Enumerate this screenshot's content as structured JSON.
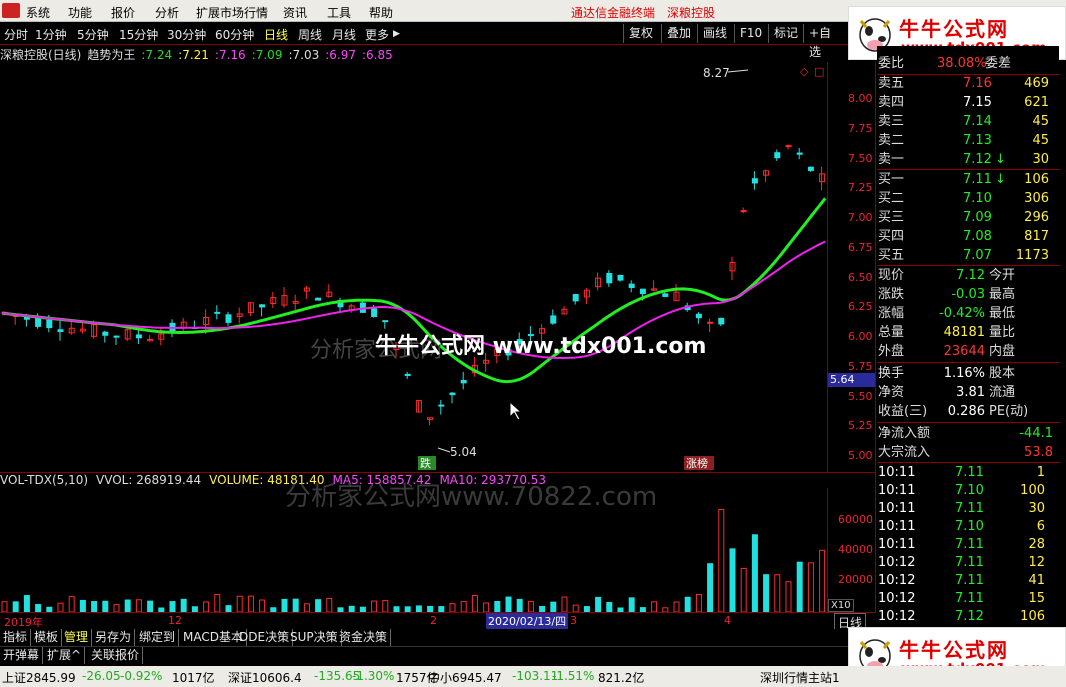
{
  "menu": {
    "items": [
      "系统",
      "功能",
      "报价",
      "分析",
      "扩展市场行情",
      "资讯",
      "工具",
      "帮助"
    ],
    "promo1": "通达信金融终端",
    "promo2": "深粮控股"
  },
  "toolbar": {
    "periods": [
      "分时",
      "1分钟",
      "5分钟",
      "15分钟",
      "30分钟",
      "60分钟",
      "日线",
      "周线",
      "月线",
      "更多"
    ],
    "active_period": "日线",
    "buttons": [
      "复权",
      "叠加",
      "画线",
      "F10",
      "标记",
      "+自选"
    ]
  },
  "chart_head": {
    "title": "深粮控股(日线)",
    "indicator": "趋势为王",
    "values": [
      ":7.24",
      ":7.21",
      ":7.16",
      ":7.09",
      ":7.03",
      ":6.97",
      ":6.85"
    ],
    "colors": [
      "#22dd22",
      "#ffee44",
      "#ff44ff",
      "#22dd22",
      "#dddddd",
      "#ff44ff",
      "#ff44ff"
    ]
  },
  "annotations": {
    "high_label": "8.27",
    "low_label": "5.04",
    "fall_tag": "跌",
    "limit_tag": "涨榜",
    "cursor_price": "5.64"
  },
  "price_axis": [
    "8.00",
    "7.75",
    "7.50",
    "7.25",
    "7.00",
    "6.75",
    "6.50",
    "6.25",
    "6.00",
    "5.75",
    "5.50",
    "5.25",
    "5.00"
  ],
  "volume": {
    "head": [
      "VOL-TDX(5,10)",
      "VVOL: 268919.44",
      "VOLUME: 48181.40",
      "MA5: 158857.42",
      "MA10: 293770.53"
    ],
    "head_colors": [
      "#dddddd",
      "#dddddd",
      "#ffee44",
      "#ff44ff",
      "#ff44ff"
    ],
    "axis": [
      "60000",
      "40000",
      "20000"
    ],
    "unit": "X10"
  },
  "date_axis": {
    "labels": [
      "2019年",
      "12",
      "2",
      "2020/02/13/四",
      "3",
      "4"
    ],
    "period_tag": "日线"
  },
  "tabs1": [
    "指标",
    "模板",
    "管理",
    "另存为",
    "绑定到",
    "MACD基本",
    "DDE决策",
    "SUP决策",
    "资金决策"
  ],
  "tabs1_active": "管理",
  "tabs2": [
    "开弹幕",
    "扩展^",
    "关联报价"
  ],
  "statusbar": [
    "上证2845.99",
    "-26.05",
    "-0.92%",
    "1017亿",
    "深证10606.4",
    "-135.65",
    "-1.30%",
    "1757亿",
    "中小6945.47",
    "-103.11",
    "-1.51%",
    "821.2亿",
    "深圳行情主站1"
  ],
  "watermark": {
    "brand": "牛牛公式网",
    "url": "www.tdx001.com",
    "overlay": "牛牛公式网 www.tdx001.com",
    "faint_overlay": "分析家公式网",
    "vol_overlay": "分析家公式网www.70822.com"
  },
  "panel": {
    "weibi": {
      "label": "委比",
      "value": "38.08%",
      "label2": "委差"
    },
    "asks": [
      {
        "label": "卖五",
        "price": "7.16",
        "vol": "469",
        "pcolor": "#ff3333"
      },
      {
        "label": "卖四",
        "price": "7.15",
        "vol": "621",
        "pcolor": "#ffffff"
      },
      {
        "label": "卖三",
        "price": "7.14",
        "vol": "45",
        "pcolor": "#22ee22"
      },
      {
        "label": "卖二",
        "price": "7.13",
        "vol": "45",
        "pcolor": "#22ee22"
      },
      {
        "label": "卖一",
        "price": "7.12",
        "vol": "30",
        "pcolor": "#22ee22",
        "arrow": "↓"
      }
    ],
    "bids": [
      {
        "label": "买一",
        "price": "7.11",
        "vol": "106",
        "arrow": "↓"
      },
      {
        "label": "买二",
        "price": "7.10",
        "vol": "306"
      },
      {
        "label": "买三",
        "price": "7.09",
        "vol": "296"
      },
      {
        "label": "买四",
        "price": "7.08",
        "vol": "817"
      },
      {
        "label": "买五",
        "price": "7.07",
        "vol": "1173"
      }
    ],
    "stats": [
      {
        "l1": "现价",
        "v1": "7.12",
        "c1": "#22ee22",
        "l2": "今开"
      },
      {
        "l1": "涨跌",
        "v1": "-0.03",
        "c1": "#22ee22",
        "l2": "最高"
      },
      {
        "l1": "涨幅",
        "v1": "-0.42%",
        "c1": "#22ee22",
        "l2": "最低"
      },
      {
        "l1": "总量",
        "v1": "48181",
        "c1": "#ffee44",
        "l2": "量比"
      },
      {
        "l1": "外盘",
        "v1": "23644",
        "c1": "#ff3333",
        "l2": "内盘"
      }
    ],
    "stats2": [
      {
        "l1": "换手",
        "v1": "1.16%",
        "l2": "股本"
      },
      {
        "l1": "净资",
        "v1": "3.81",
        "l2": "流通"
      },
      {
        "l1": "收益(三)",
        "v1": "0.286",
        "l2": "PE(动)"
      }
    ],
    "flows": [
      {
        "label": "净流入额",
        "value": "-44.1",
        "color": "#22ee22"
      },
      {
        "label": "大宗流入",
        "value": "53.8",
        "color": "#ff3333"
      }
    ],
    "ticks": [
      {
        "time": "10:11",
        "price": "7.11",
        "vol": "1"
      },
      {
        "time": "10:11",
        "price": "7.10",
        "vol": "100"
      },
      {
        "time": "10:11",
        "price": "7.11",
        "vol": "30"
      },
      {
        "time": "10:11",
        "price": "7.10",
        "vol": "6"
      },
      {
        "time": "10:11",
        "price": "7.11",
        "vol": "28"
      },
      {
        "time": "10:12",
        "price": "7.11",
        "vol": "12"
      },
      {
        "time": "10:12",
        "price": "7.11",
        "vol": "41"
      },
      {
        "time": "10:12",
        "price": "7.11",
        "vol": "15"
      },
      {
        "time": "10:12",
        "price": "7.12",
        "vol": "106"
      }
    ]
  },
  "colors": {
    "up": "#ff2a2a",
    "down": "#22e0e0",
    "green": "#22ee22",
    "magenta": "#ee22ee",
    "axis": "#e02222"
  }
}
